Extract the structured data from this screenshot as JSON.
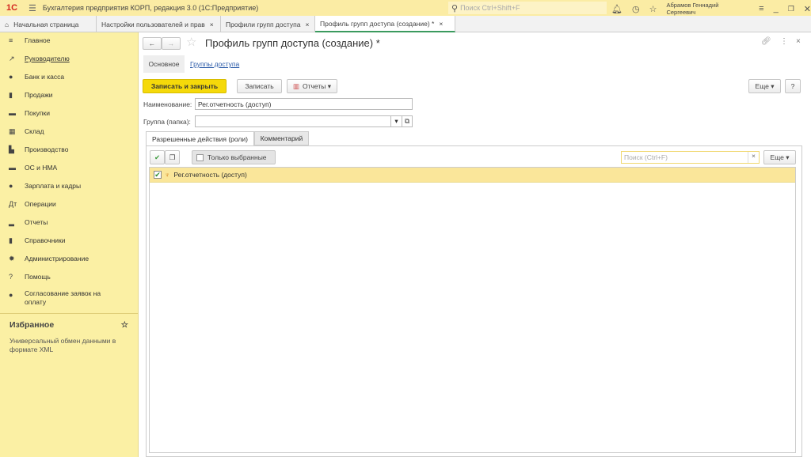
{
  "app": {
    "title": "Бухгалтерия предприятия КОРП, редакция 3.0  (1С:Предприятие)",
    "logo": "1С",
    "search_placeholder": "Поиск Ctrl+Shift+F",
    "user": "Абрамов Геннадий Сергеевич"
  },
  "tabs": [
    {
      "label": "Начальная страница"
    },
    {
      "label": "Настройки пользователей и прав"
    },
    {
      "label": "Профили групп доступа"
    },
    {
      "label": "Профиль групп доступа (создание) *"
    }
  ],
  "sidebar": {
    "items": [
      {
        "label": "Главное",
        "icon": "≡"
      },
      {
        "label": "Руководителю",
        "icon": "↗"
      },
      {
        "label": "Банк и касса",
        "icon": "●"
      },
      {
        "label": "Продажи",
        "icon": "▮"
      },
      {
        "label": "Покупки",
        "icon": "▬"
      },
      {
        "label": "Склад",
        "icon": "▦"
      },
      {
        "label": "Производство",
        "icon": "▙"
      },
      {
        "label": "ОС и НМА",
        "icon": "▬"
      },
      {
        "label": "Зарплата и кадры",
        "icon": "●"
      },
      {
        "label": "Операции",
        "icon": "Дт"
      },
      {
        "label": "Отчеты",
        "icon": "▂"
      },
      {
        "label": "Справочники",
        "icon": "▮"
      },
      {
        "label": "Администрирование",
        "icon": "✹"
      },
      {
        "label": "Помощь",
        "icon": "?"
      },
      {
        "label": "Согласование заявок на оплату",
        "icon": "●"
      }
    ],
    "favorites_title": "Избранное",
    "favorites": [
      "Универсальный обмен данными в формате XML"
    ]
  },
  "form": {
    "title": "Профиль групп доступа (создание) *",
    "nav_main": "Основное",
    "nav_groups": "Группы доступа",
    "save_close": "Записать и закрыть",
    "save": "Записать",
    "reports": "Отчеты",
    "more": "Еще",
    "help": "?",
    "name_label": "Наименование:",
    "name_value": "Рег.отчетность  (доступ)",
    "group_label": "Группа (папка):",
    "group_value": "",
    "tab_roles": "Разрешенные действия (роли)",
    "tab_comment": "Комментарий",
    "only_selected": "Только выбранные",
    "search_placeholder": "Поиск (Ctrl+F)",
    "more2": "Еще",
    "rows": [
      {
        "label": "Рег.отчетность  (доступ)",
        "checked": true
      }
    ]
  },
  "colors": {
    "accent": "#f5d90a",
    "sidebar": "#fbf0a4",
    "selected_row": "#fae69a"
  }
}
